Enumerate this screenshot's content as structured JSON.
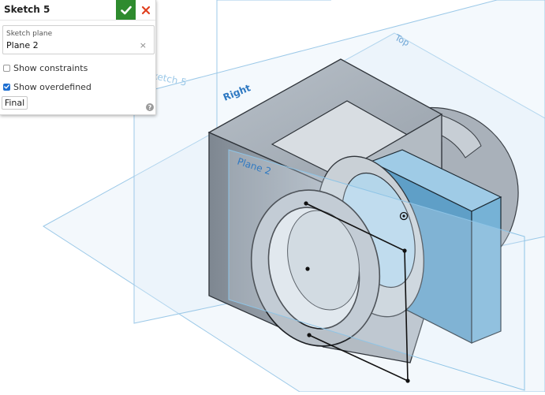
{
  "dialog": {
    "title": "Sketch 5",
    "sketch_plane_label": "Sketch plane",
    "sketch_plane_value": "Plane 2",
    "clear_symbol": "×",
    "show_constraints_label": "Show constraints",
    "show_constraints_checked": false,
    "show_overdefined_label": "Show overdefined",
    "show_overdefined_checked": true,
    "final_label": "Final",
    "help_symbol": "?",
    "accept_icon": "check-icon",
    "cancel_icon": "close-icon"
  },
  "viewport": {
    "plane_labels": {
      "top": "Top",
      "right": "Right",
      "plane2": "Plane 2",
      "sketch5": "Sketch 5"
    }
  },
  "colors": {
    "accept": "#2e8b2e",
    "cancel": "#e0401f",
    "plane_edge": "#8ec4e6",
    "plane_label": "#2f79c2",
    "part_body": "#9aa3ad",
    "highlight_face": "#6fb0d8"
  }
}
